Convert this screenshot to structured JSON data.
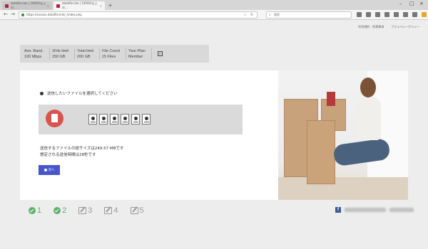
{
  "browser": {
    "tabs": [
      {
        "label": "datafile.link | 1000円以上の..."
      },
      {
        "label": "datafile.link | 1000円以上の..."
      }
    ],
    "url": "https://xxxxxx.datafile.link/_/index.php",
    "search_placeholder": "検索",
    "new_tab": "+",
    "close": "×"
  },
  "header_links": [
    {
      "label": "利用規約・免責事項"
    },
    {
      "label": "プライバシーポリシー"
    }
  ],
  "stats": [
    {
      "label": "Ave. Band.",
      "value": "100 Mbps"
    },
    {
      "label": "1File limit",
      "value": "150 GB"
    },
    {
      "label": "Total limit",
      "value": "200 GB"
    },
    {
      "label": "File Count",
      "value": "15 Files"
    },
    {
      "label": "Your Plan",
      "value": "Member"
    }
  ],
  "upload": {
    "heading": "送信したいファイルを選択してください",
    "file_count_shown": 6,
    "total_size_text": "送信するファイルの総サイズは249.57 MBです",
    "estimated_time_text": "想定される送信時間は28秒です",
    "next_button": "次へ"
  },
  "steps": [
    {
      "number": "1",
      "status": "done"
    },
    {
      "number": "2",
      "status": "done"
    },
    {
      "number": "3",
      "status": "pending"
    },
    {
      "number": "4",
      "status": "pending"
    },
    {
      "number": "5",
      "status": "pending"
    }
  ],
  "colors": {
    "accent_button": "#4856cc",
    "step_done": "#5db26a",
    "step_pending": "#9a9a9a",
    "upload_icon": "#d9534f"
  }
}
